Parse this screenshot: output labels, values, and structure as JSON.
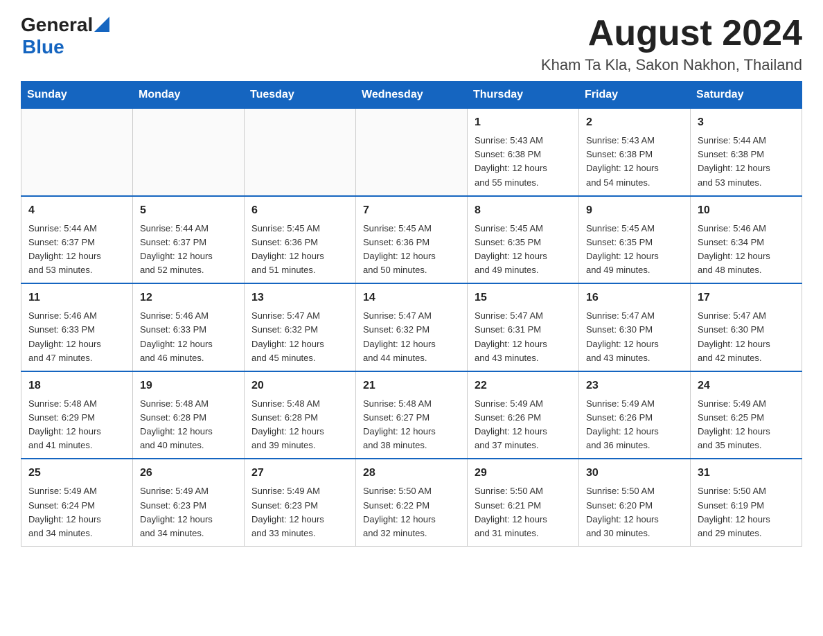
{
  "header": {
    "logo_general": "General",
    "logo_blue": "Blue",
    "month_year": "August 2024",
    "location": "Kham Ta Kla, Sakon Nakhon, Thailand"
  },
  "calendar": {
    "days_of_week": [
      "Sunday",
      "Monday",
      "Tuesday",
      "Wednesday",
      "Thursday",
      "Friday",
      "Saturday"
    ],
    "weeks": [
      [
        {
          "day": "",
          "info": ""
        },
        {
          "day": "",
          "info": ""
        },
        {
          "day": "",
          "info": ""
        },
        {
          "day": "",
          "info": ""
        },
        {
          "day": "1",
          "info": "Sunrise: 5:43 AM\nSunset: 6:38 PM\nDaylight: 12 hours\nand 55 minutes."
        },
        {
          "day": "2",
          "info": "Sunrise: 5:43 AM\nSunset: 6:38 PM\nDaylight: 12 hours\nand 54 minutes."
        },
        {
          "day": "3",
          "info": "Sunrise: 5:44 AM\nSunset: 6:38 PM\nDaylight: 12 hours\nand 53 minutes."
        }
      ],
      [
        {
          "day": "4",
          "info": "Sunrise: 5:44 AM\nSunset: 6:37 PM\nDaylight: 12 hours\nand 53 minutes."
        },
        {
          "day": "5",
          "info": "Sunrise: 5:44 AM\nSunset: 6:37 PM\nDaylight: 12 hours\nand 52 minutes."
        },
        {
          "day": "6",
          "info": "Sunrise: 5:45 AM\nSunset: 6:36 PM\nDaylight: 12 hours\nand 51 minutes."
        },
        {
          "day": "7",
          "info": "Sunrise: 5:45 AM\nSunset: 6:36 PM\nDaylight: 12 hours\nand 50 minutes."
        },
        {
          "day": "8",
          "info": "Sunrise: 5:45 AM\nSunset: 6:35 PM\nDaylight: 12 hours\nand 49 minutes."
        },
        {
          "day": "9",
          "info": "Sunrise: 5:45 AM\nSunset: 6:35 PM\nDaylight: 12 hours\nand 49 minutes."
        },
        {
          "day": "10",
          "info": "Sunrise: 5:46 AM\nSunset: 6:34 PM\nDaylight: 12 hours\nand 48 minutes."
        }
      ],
      [
        {
          "day": "11",
          "info": "Sunrise: 5:46 AM\nSunset: 6:33 PM\nDaylight: 12 hours\nand 47 minutes."
        },
        {
          "day": "12",
          "info": "Sunrise: 5:46 AM\nSunset: 6:33 PM\nDaylight: 12 hours\nand 46 minutes."
        },
        {
          "day": "13",
          "info": "Sunrise: 5:47 AM\nSunset: 6:32 PM\nDaylight: 12 hours\nand 45 minutes."
        },
        {
          "day": "14",
          "info": "Sunrise: 5:47 AM\nSunset: 6:32 PM\nDaylight: 12 hours\nand 44 minutes."
        },
        {
          "day": "15",
          "info": "Sunrise: 5:47 AM\nSunset: 6:31 PM\nDaylight: 12 hours\nand 43 minutes."
        },
        {
          "day": "16",
          "info": "Sunrise: 5:47 AM\nSunset: 6:30 PM\nDaylight: 12 hours\nand 43 minutes."
        },
        {
          "day": "17",
          "info": "Sunrise: 5:47 AM\nSunset: 6:30 PM\nDaylight: 12 hours\nand 42 minutes."
        }
      ],
      [
        {
          "day": "18",
          "info": "Sunrise: 5:48 AM\nSunset: 6:29 PM\nDaylight: 12 hours\nand 41 minutes."
        },
        {
          "day": "19",
          "info": "Sunrise: 5:48 AM\nSunset: 6:28 PM\nDaylight: 12 hours\nand 40 minutes."
        },
        {
          "day": "20",
          "info": "Sunrise: 5:48 AM\nSunset: 6:28 PM\nDaylight: 12 hours\nand 39 minutes."
        },
        {
          "day": "21",
          "info": "Sunrise: 5:48 AM\nSunset: 6:27 PM\nDaylight: 12 hours\nand 38 minutes."
        },
        {
          "day": "22",
          "info": "Sunrise: 5:49 AM\nSunset: 6:26 PM\nDaylight: 12 hours\nand 37 minutes."
        },
        {
          "day": "23",
          "info": "Sunrise: 5:49 AM\nSunset: 6:26 PM\nDaylight: 12 hours\nand 36 minutes."
        },
        {
          "day": "24",
          "info": "Sunrise: 5:49 AM\nSunset: 6:25 PM\nDaylight: 12 hours\nand 35 minutes."
        }
      ],
      [
        {
          "day": "25",
          "info": "Sunrise: 5:49 AM\nSunset: 6:24 PM\nDaylight: 12 hours\nand 34 minutes."
        },
        {
          "day": "26",
          "info": "Sunrise: 5:49 AM\nSunset: 6:23 PM\nDaylight: 12 hours\nand 34 minutes."
        },
        {
          "day": "27",
          "info": "Sunrise: 5:49 AM\nSunset: 6:23 PM\nDaylight: 12 hours\nand 33 minutes."
        },
        {
          "day": "28",
          "info": "Sunrise: 5:50 AM\nSunset: 6:22 PM\nDaylight: 12 hours\nand 32 minutes."
        },
        {
          "day": "29",
          "info": "Sunrise: 5:50 AM\nSunset: 6:21 PM\nDaylight: 12 hours\nand 31 minutes."
        },
        {
          "day": "30",
          "info": "Sunrise: 5:50 AM\nSunset: 6:20 PM\nDaylight: 12 hours\nand 30 minutes."
        },
        {
          "day": "31",
          "info": "Sunrise: 5:50 AM\nSunset: 6:19 PM\nDaylight: 12 hours\nand 29 minutes."
        }
      ]
    ]
  }
}
